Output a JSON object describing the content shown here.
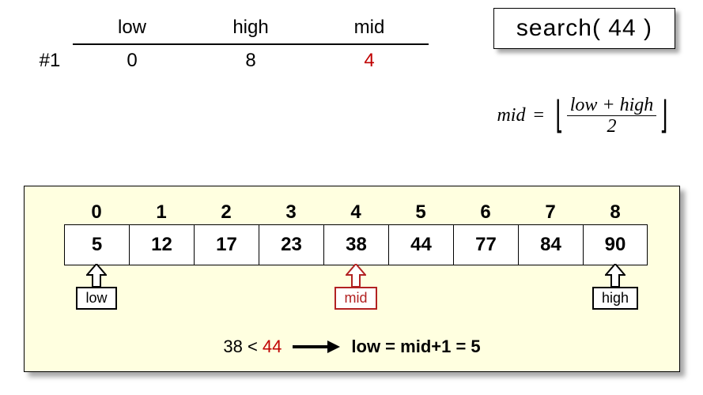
{
  "trace": {
    "headers": {
      "low": "low",
      "high": "high",
      "mid": "mid"
    },
    "step_label": "#1",
    "low": "0",
    "high": "8",
    "mid": "4"
  },
  "searchbox": {
    "text": "search( 44 )"
  },
  "formula": {
    "lhs": "mid",
    "eq": "=",
    "num": "low + high",
    "den": "2",
    "lfloor": "⌊",
    "rfloor": "⌋"
  },
  "array": {
    "indices": [
      "0",
      "1",
      "2",
      "3",
      "4",
      "5",
      "6",
      "7",
      "8"
    ],
    "values": [
      "5",
      "12",
      "17",
      "23",
      "38",
      "44",
      "77",
      "84",
      "90"
    ]
  },
  "pointers": {
    "low": {
      "label": "low",
      "at": 0
    },
    "mid": {
      "label": "mid",
      "at": 4
    },
    "high": {
      "label": "high",
      "at": 8
    }
  },
  "comparison": {
    "lhs_value": "38",
    "op": "<",
    "target": "44",
    "arrow": "→",
    "result": "low = mid+1 = 5"
  }
}
